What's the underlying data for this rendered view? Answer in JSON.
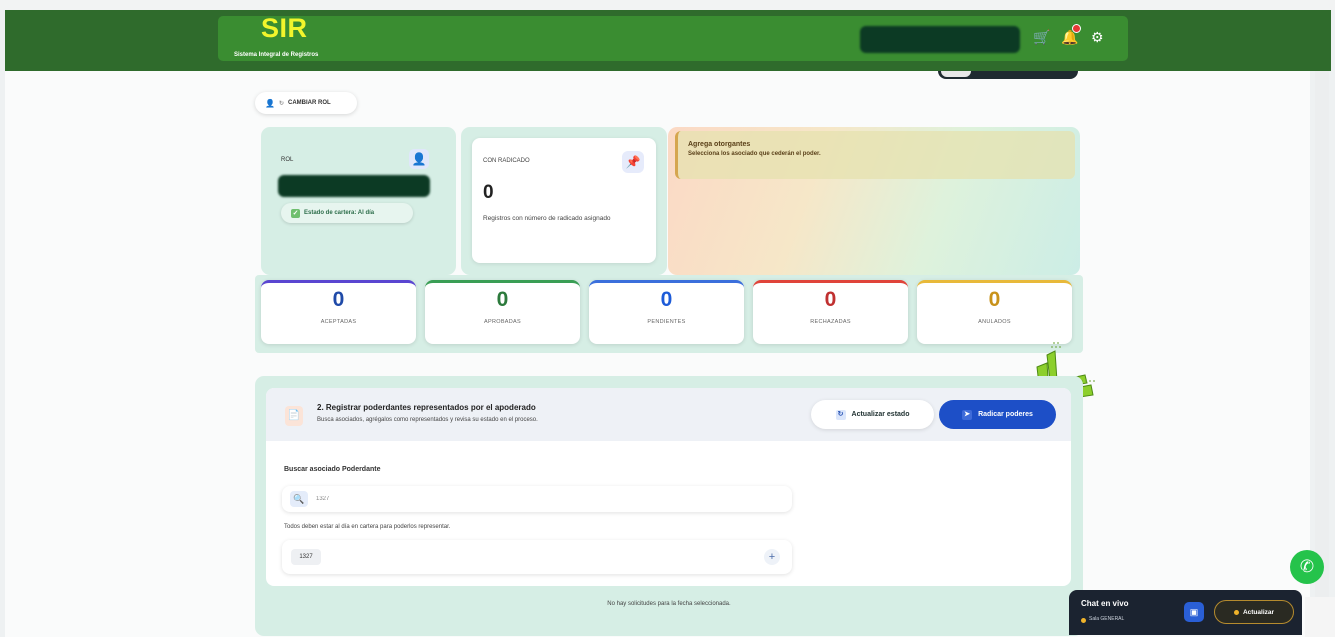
{
  "header": {
    "logo": "SIR",
    "logo_subtitle": "Sistema Integral de Registros",
    "icons": [
      "cart-icon",
      "bell-icon",
      "gear-icon"
    ]
  },
  "role_button": {
    "label": "CAMBIAR ROL"
  },
  "rol_card": {
    "label": "ROL",
    "cartera_status": "Estado de cartera: Al día"
  },
  "radicado_card": {
    "label": "CON RADICADO",
    "value": "0",
    "description": "Registros con número de radicado asignado"
  },
  "otorgantes_banner": {
    "title": "Agrega otorgantes",
    "subtitle": "Selecciona los asociado que cederán el poder."
  },
  "stats": [
    {
      "value": "0",
      "label": "ACEPTADAS",
      "color": "#1f4aa8",
      "bar": "#5a46d1"
    },
    {
      "value": "0",
      "label": "APROBADAS",
      "color": "#2c7a3c",
      "bar": "#3a9e55"
    },
    {
      "value": "0",
      "label": "PENDIENTES",
      "color": "#1d5bd8",
      "bar": "#3b6fdc"
    },
    {
      "value": "0",
      "label": "RECHAZADAS",
      "color": "#c03030",
      "bar": "#e0443a"
    },
    {
      "value": "0",
      "label": "ANULADOS",
      "color": "#c8921a",
      "bar": "#e8b93a"
    }
  ],
  "section": {
    "title": "2. Registrar poderdantes representados por el apoderado",
    "subtitle": "Busca asociados, agrégalos como representados y revisa su estado en el proceso.",
    "update_button": "Actualizar estado",
    "submit_button": "Radicar poderes",
    "search_label": "Buscar asociado Poderdante",
    "search_value": "1327",
    "help_text": "Todos deben estar al día en cartera para poderlos representar.",
    "tag": "1327",
    "empty_text": "No hay solicitudes para la fecha seleccionada."
  },
  "chat": {
    "title": "Chat en vivo",
    "subtitle": "Sala GENERAL",
    "button": "Actualizar"
  },
  "colors": {
    "header_dark": "#2f6b2c",
    "header_light": "#3a8d31",
    "logo_yellow": "#f2f52c",
    "accent_blue": "#1d4fc7"
  }
}
